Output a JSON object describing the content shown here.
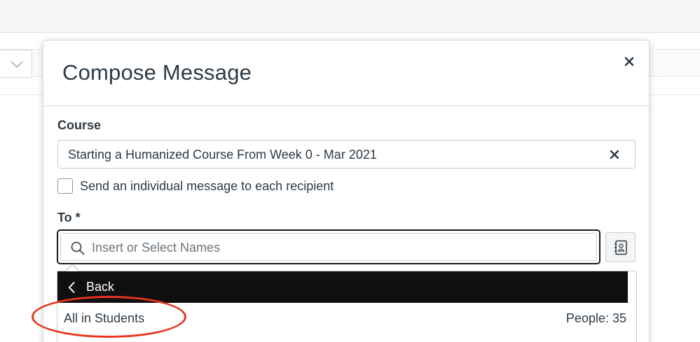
{
  "modal": {
    "title": "Compose Message"
  },
  "course": {
    "label": "Course",
    "value": "Starting a Humanized Course From Week 0 - Mar 2021"
  },
  "individual_message": {
    "label": "Send an individual message to each recipient",
    "checked": false
  },
  "to": {
    "label": "To *",
    "placeholder": "Insert or Select Names"
  },
  "recipient_menu": {
    "back_label": "Back",
    "groups": [
      {
        "name": "All in Students",
        "count_text": "People: 35"
      }
    ]
  },
  "icons": {
    "close": "close-icon",
    "clear": "clear-icon",
    "search": "search-icon",
    "address_book": "address-book-icon",
    "back": "chevron-left-icon",
    "dropdown": "chevron-down-icon"
  },
  "colors": {
    "text": "#2d3b45",
    "back_bar": "#0f0f0f",
    "annotation": "#e8341c",
    "focus_border": "#1b1b1b"
  }
}
